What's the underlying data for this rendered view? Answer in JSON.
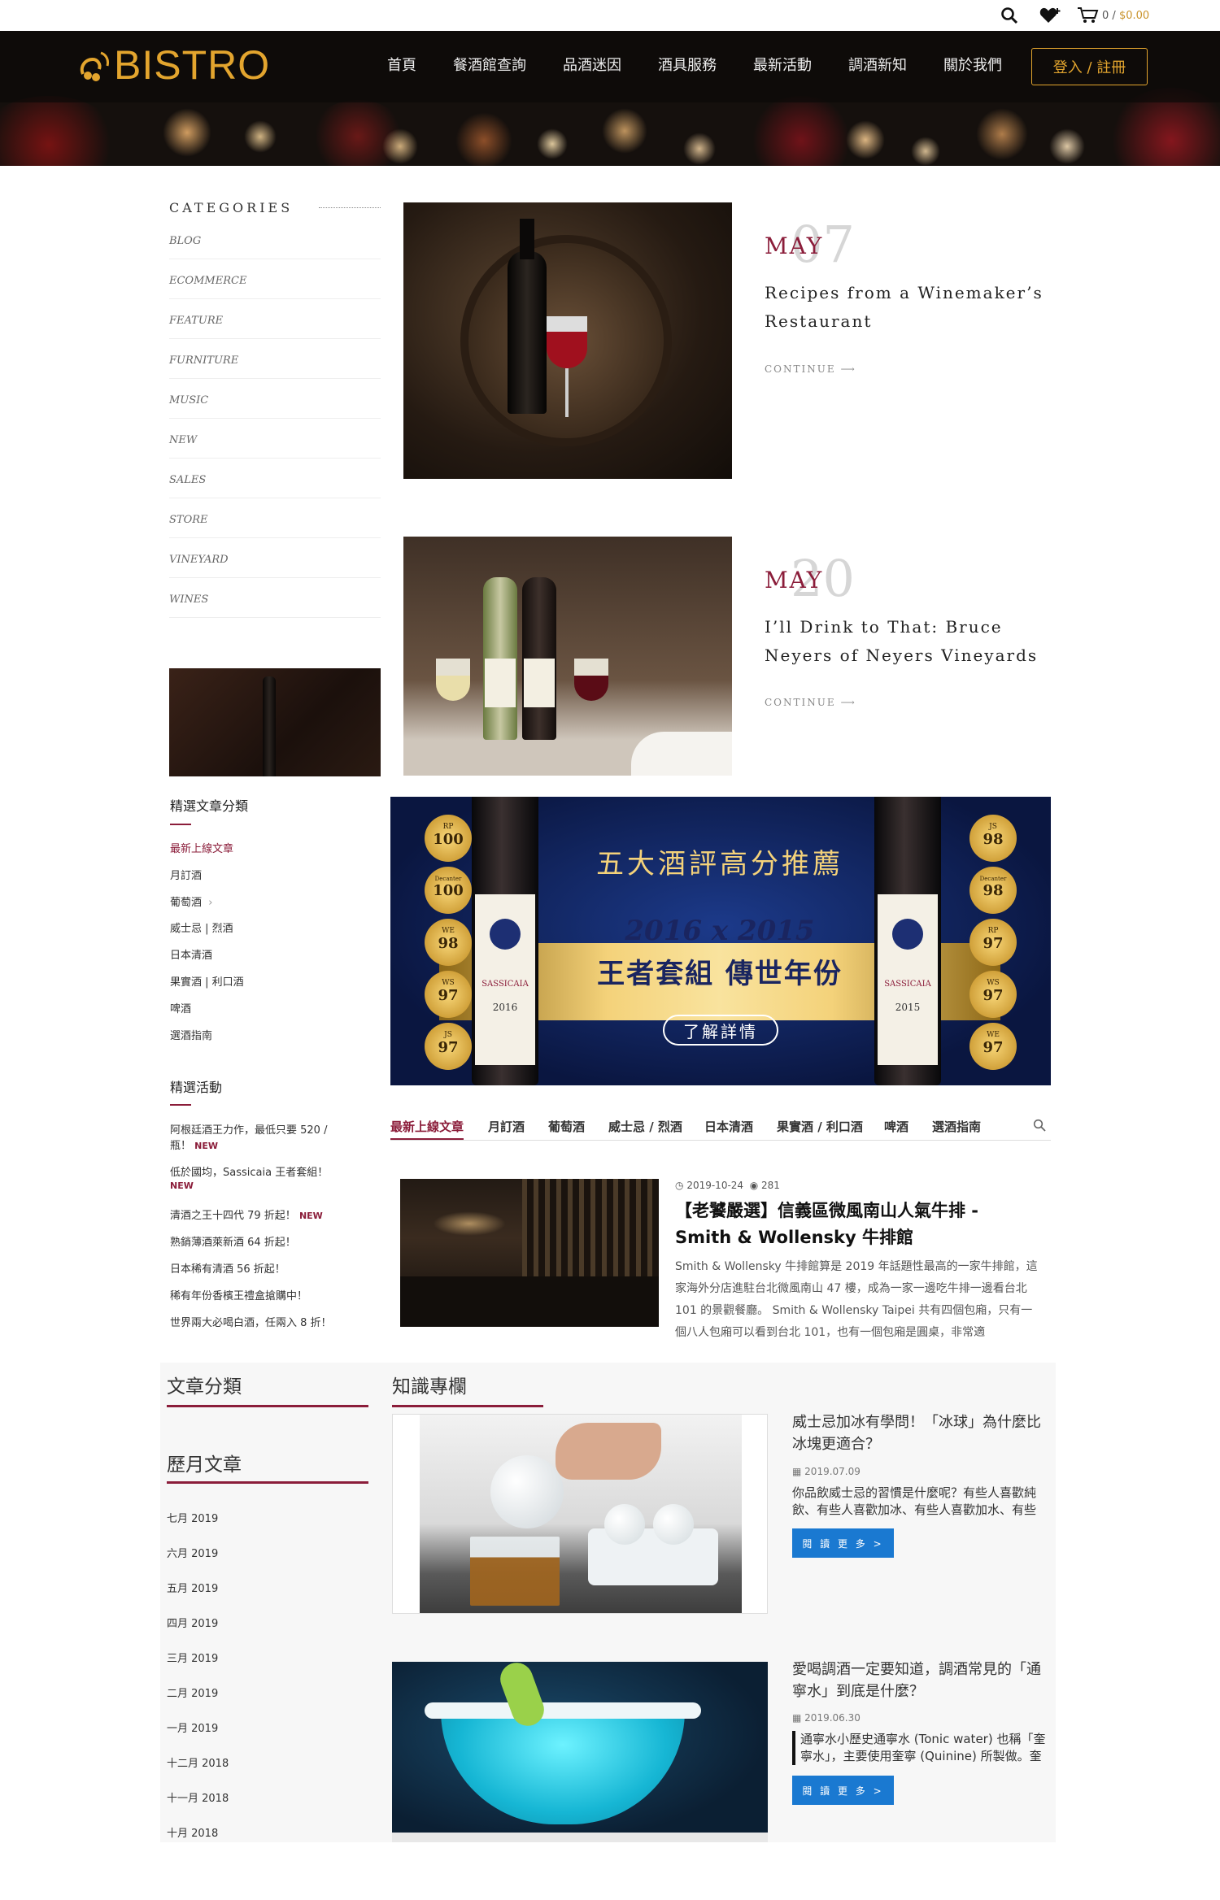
{
  "topbar": {
    "cart_count": "0 /",
    "cart_amount": "$0.00"
  },
  "header": {
    "logo_text": "BISTRO",
    "login_label": "登入 / 註冊"
  },
  "nav": [
    "首頁",
    "餐酒館查詢",
    "品酒迷因",
    "酒具服務",
    "最新活動",
    "調酒新知",
    "關於我們"
  ],
  "categories": {
    "title": "CATEGORIES",
    "items": [
      "BLOG",
      "ECOMMERCE",
      "FEATURE",
      "FURNITURE",
      "MUSIC",
      "NEW",
      "SALES",
      "STORE",
      "VINEYARD",
      "WINES"
    ]
  },
  "posts": [
    {
      "month": "MAY",
      "day": "07",
      "title": "Recipes from a Winemaker’s Restaurant",
      "continue": "CONTINUE"
    },
    {
      "month": "MAY",
      "day": "20",
      "title": "I’ll Drink to That: Bruce Neyers of Neyers Vineyards",
      "continue": "CONTINUE"
    }
  ],
  "featured_categories": {
    "title": "精選文章分類",
    "items": [
      "最新上線文章",
      "月訂酒",
      "葡萄酒",
      "威士忌 | 烈酒",
      "日本清酒",
      "果實酒 | 利口酒",
      "啤酒",
      "選酒指南"
    ]
  },
  "featured_events": {
    "title": "精選活動",
    "new_label": "NEW",
    "items": [
      {
        "line1": "阿根廷酒王力作，最低只要 520 /",
        "line2": "瓶！"
      },
      {
        "line1": "低於國均，Sassicaia 王者套組！",
        "line2": ""
      },
      {
        "line1": "清酒之王十四代 79 折起！",
        "line2": ""
      },
      {
        "line1": "熟銷薄酒萊新酒 64 折起！",
        "line2": ""
      },
      {
        "line1": "日本稀有清酒 56 折起！",
        "line2": ""
      },
      {
        "line1": "稀有年份香檳王禮盒搶購中！",
        "line2": ""
      },
      {
        "line1": "世界兩大必喝白酒，任兩入 8 折！",
        "line2": ""
      }
    ]
  },
  "banner": {
    "headline": "五大酒評高分推薦",
    "years": "2016 x 2015",
    "subline": "王者套組 傳世年份",
    "cta": "了解詳情",
    "bottle_label": "SASSICAIA",
    "year_left": "2016",
    "year_right": "2015",
    "medals_left": [
      {
        "t": "RP",
        "n": "100"
      },
      {
        "t": "Decanter",
        "n": "100"
      },
      {
        "t": "WE",
        "n": "98"
      },
      {
        "t": "WS",
        "n": "97"
      },
      {
        "t": "JS",
        "n": "97"
      }
    ],
    "medals_right": [
      {
        "t": "JS",
        "n": "98"
      },
      {
        "t": "Decanter",
        "n": "98"
      },
      {
        "t": "RP",
        "n": "97"
      },
      {
        "t": "WS",
        "n": "97"
      },
      {
        "t": "WE",
        "n": "97"
      }
    ]
  },
  "article_tabs": [
    "最新上線文章",
    "月訂酒",
    "葡萄酒",
    "威士忌 / 烈酒",
    "日本清酒",
    "果實酒 / 利口酒",
    "啤酒",
    "選酒指南"
  ],
  "article": {
    "date": "2019-10-24",
    "views": "281",
    "title": "【老饕嚴選】信義區微風南山人氣牛排 - Smith & Wollensky 牛排館",
    "body": "Smith & Wollensky 牛排館算是 2019 年話題性最高的一家牛排館，這家海外分店進駐台北微風南山 47 樓，成為一家一邊吃牛排一邊看台北 101 的景觀餐廳。 Smith & Wollensky Taipei 共有四個包廂，只有一個八人包廂可以看到台北 101，也有一個包廂是圓桌，非常適"
  },
  "blocks": {
    "article_categories": "文章分類",
    "archives": "歷月文章",
    "knowledge": "知識專欄"
  },
  "archives": [
    "七月 2019",
    "六月 2019",
    "五月 2019",
    "四月 2019",
    "三月 2019",
    "二月 2019",
    "一月 2019",
    "十二月 2018",
    "十一月 2018",
    "十月 2018"
  ],
  "knowledge": [
    {
      "title": "威士忌加冰有學問！「冰球」為什麼比冰塊更適合？",
      "date": "2019.07.09",
      "summary": "你品飲威士忌的習慣是什麼呢？有些人喜歡純飲、有些人喜歡加冰、有些人喜歡加水、有些",
      "btn": "閱 讀 更 多 >"
    },
    {
      "title": "愛喝調酒一定要知道，調酒常見的「通寧水」到底是什麼？",
      "date": "2019.06.30",
      "summary": "通寧水小歷史通寧水 (Tonic water) 也稱「奎寧水」，主要使用奎寧 (Quinine) 所製做。奎",
      "btn": "閱 讀 更 多 >"
    }
  ],
  "colors": {
    "accent": "#8b1d3a",
    "gold": "#e3a52e",
    "button_blue": "#1a79d1",
    "header_bg": "#15100d"
  }
}
